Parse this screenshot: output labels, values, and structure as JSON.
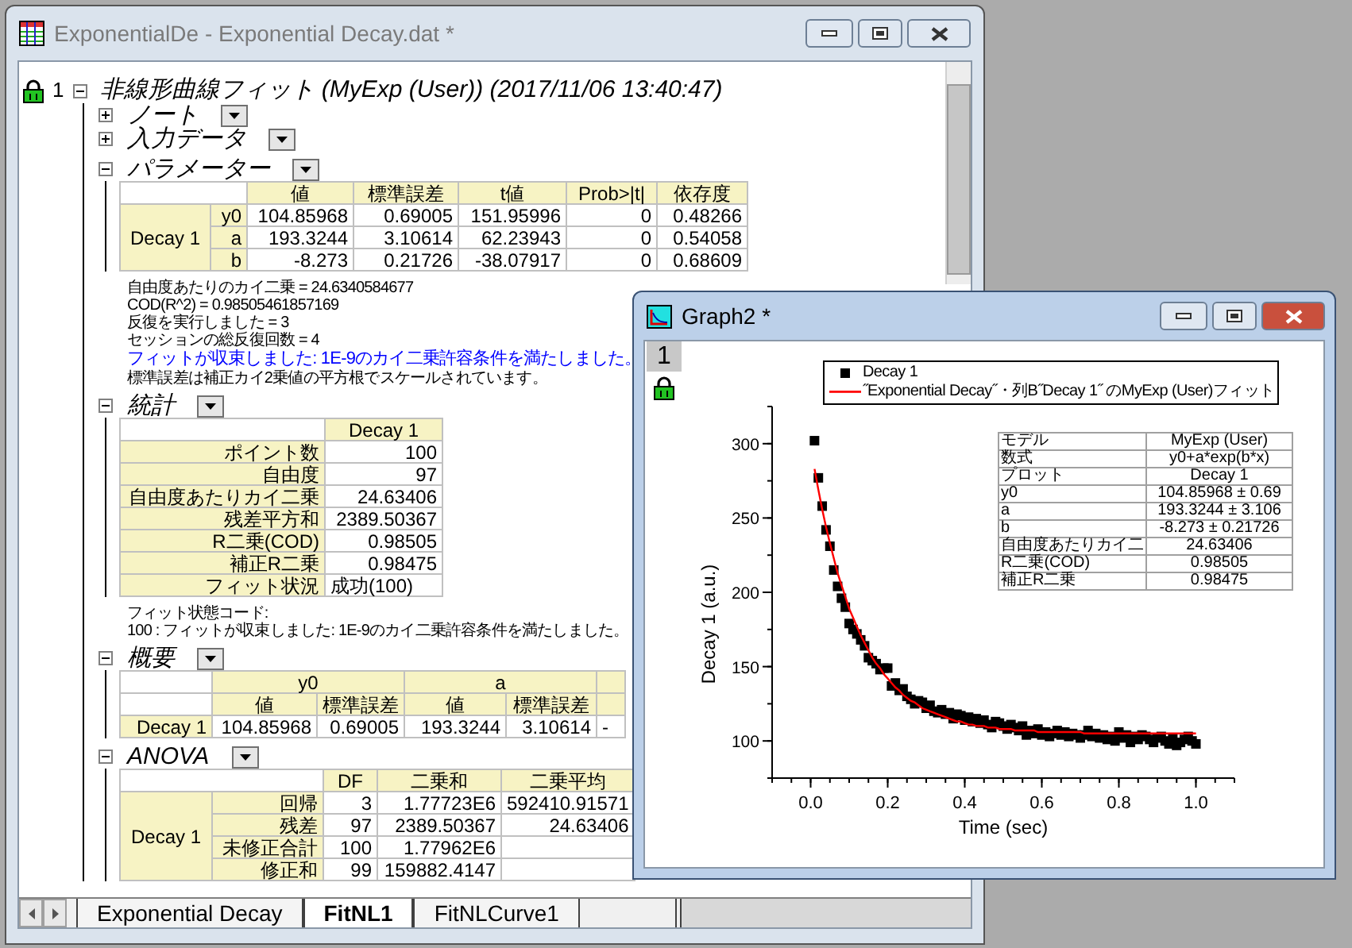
{
  "report_window": {
    "title": "ExponentialDe - Exponential Decay.dat *",
    "active": false,
    "layer": "1",
    "report": {
      "title": "非線形曲線フィット (MyExp (User)) (2017/11/06 13:40:47)",
      "expanded": true
    },
    "sections": [
      {
        "kind": "heading",
        "title": "ノート",
        "expanded": false
      },
      {
        "kind": "heading",
        "title": "入力データ",
        "expanded": false
      },
      {
        "kind": "parameters",
        "title": "パラメーター",
        "expanded": true,
        "columns": [
          "値",
          "標準誤差",
          "t値",
          "Prob>|t|",
          "依存度"
        ],
        "group": "Decay 1",
        "rows": [
          {
            "label": "y0",
            "cells": [
              "104.85968",
              "0.69005",
              "151.95996",
              "0",
              "0.48266"
            ]
          },
          {
            "label": "a",
            "cells": [
              "193.3244",
              "3.10614",
              "62.23943",
              "0",
              "0.54058"
            ]
          },
          {
            "label": "b",
            "cells": [
              "-8.273",
              "0.21726",
              "-38.07917",
              "0",
              "0.68609"
            ]
          }
        ],
        "notes": [
          {
            "kind": "plain",
            "text": "自由度あたりのカイ二乗 = 24.6340584677"
          },
          {
            "kind": "plain",
            "text": "COD(R^2) = 0.98505461857169"
          },
          {
            "kind": "plain",
            "text": "反復を実行しました = 3"
          },
          {
            "kind": "plain",
            "text": "セッションの総反復回数 = 4"
          },
          {
            "kind": "message",
            "text": "フィットが収束しました:  1E-9のカイ二乗許容条件を満たしました。"
          },
          {
            "kind": "plain",
            "text": "標準誤差は補正カイ2乗値の平方根でスケールされています。"
          }
        ]
      },
      {
        "kind": "statistics",
        "title": "統計",
        "expanded": true,
        "column": "Decay 1",
        "rows": [
          {
            "label": "ポイント数",
            "value": "100",
            "kind": "number"
          },
          {
            "label": "自由度",
            "value": "97",
            "kind": "number"
          },
          {
            "label": "自由度あたりカイ二乗",
            "value": "24.63406",
            "kind": "number"
          },
          {
            "label": "残差平方和",
            "value": "2389.50367",
            "kind": "number"
          },
          {
            "label": "R二乗(COD)",
            "value": "0.98505",
            "kind": "number"
          },
          {
            "label": "補正R二乗",
            "value": "0.98475",
            "kind": "number"
          },
          {
            "label": "フィット状況",
            "value": "成功(100)",
            "kind": "text"
          }
        ],
        "notes": [
          {
            "kind": "plain",
            "text": "フィット状態コード:"
          },
          {
            "kind": "plain",
            "text": "100 : フィットが収束しました:  1E-9のカイ二乗許容条件を満たしました。"
          }
        ]
      },
      {
        "kind": "summary",
        "title": "概要",
        "expanded": true,
        "groups": [
          "y0",
          "a"
        ],
        "subcolumns": [
          "値",
          "標準誤差",
          "値",
          "標準誤差"
        ],
        "rows": [
          {
            "label": "Decay 1",
            "cells": [
              "104.85968",
              "0.69005",
              "193.3244",
              "3.10614",
              "-"
            ]
          }
        ]
      },
      {
        "kind": "anova",
        "title": "ANOVA",
        "expanded": true,
        "columns": [
          "DF",
          "二乗和",
          "二乗平均"
        ],
        "group": "Decay 1",
        "rows": [
          {
            "label": "回帰",
            "cells": [
              "3",
              "1.77723E6",
              "592410.91571"
            ]
          },
          {
            "label": "残差",
            "cells": [
              "97",
              "2389.50367",
              "24.63406"
            ]
          },
          {
            "label": "未修正合計",
            "cells": [
              "100",
              "1.77962E6"
            ]
          },
          {
            "label": "修正和",
            "cells": [
              "99",
              "159882.4147"
            ]
          }
        ]
      }
    ],
    "sheet_tabs": [
      {
        "label": "Exponential Decay",
        "selected": false
      },
      {
        "label": "FitNL1",
        "selected": true
      },
      {
        "label": "FitNLCurve1",
        "selected": false
      }
    ]
  },
  "graph_window": {
    "title": "Graph2 *",
    "active": true,
    "layer": "1",
    "fit_table": [
      {
        "label": "モデル",
        "value": "MyExp (User)"
      },
      {
        "label": "数式",
        "value": "y0+a*exp(b*x)"
      },
      {
        "label": "プロット",
        "value": "Decay 1"
      },
      {
        "label": "y0",
        "value": "104.85968 ± 0.69"
      },
      {
        "label": "a",
        "value": "193.3244 ± 3.106"
      },
      {
        "label": "b",
        "value": "-8.273 ± 0.21726"
      },
      {
        "label": "自由度あたりカイ二",
        "value": "24.63406"
      },
      {
        "label": "R二乗(COD)",
        "value": "0.98505"
      },
      {
        "label": "補正R二乗",
        "value": "0.98475"
      }
    ],
    "chart_data": {
      "type": "scatter",
      "xlabel": "Time (sec)",
      "ylabel": "Decay 1 (a.u.)",
      "xlim": [
        -0.1,
        1.1
      ],
      "ylim": [
        75,
        325
      ],
      "xticks": [
        {
          "value": 0,
          "label": "0.0"
        },
        {
          "value": 0.2,
          "label": "0.2"
        },
        {
          "value": 0.4,
          "label": "0.4"
        },
        {
          "value": 0.6,
          "label": "0.6"
        },
        {
          "value": 0.8,
          "label": "0.8"
        },
        {
          "value": 1,
          "label": "1.0"
        }
      ],
      "yticks": [
        100,
        150,
        200,
        250,
        300
      ],
      "x": [
        0.01,
        0.02,
        0.03,
        0.04,
        0.05,
        0.06,
        0.07,
        0.08,
        0.09,
        0.1,
        0.11,
        0.12,
        0.13,
        0.14,
        0.15,
        0.16,
        0.17,
        0.18,
        0.19,
        0.2,
        0.21,
        0.22,
        0.23,
        0.24,
        0.25,
        0.26,
        0.27,
        0.28,
        0.29,
        0.3,
        0.31,
        0.32,
        0.33,
        0.34,
        0.35,
        0.36,
        0.37,
        0.38,
        0.39,
        0.4,
        0.41,
        0.42,
        0.43,
        0.44,
        0.45,
        0.46,
        0.47,
        0.48,
        0.49,
        0.5,
        0.51,
        0.52,
        0.53,
        0.54,
        0.55,
        0.56,
        0.57,
        0.58,
        0.59,
        0.6,
        0.61,
        0.62,
        0.63,
        0.64,
        0.65,
        0.66,
        0.67,
        0.68,
        0.69,
        0.7,
        0.71,
        0.72,
        0.73,
        0.74,
        0.75,
        0.76,
        0.77,
        0.78,
        0.79,
        0.8,
        0.81,
        0.82,
        0.83,
        0.84,
        0.85,
        0.86,
        0.87,
        0.88,
        0.89,
        0.9,
        0.91,
        0.92,
        0.93,
        0.94,
        0.95,
        0.96,
        0.97,
        0.98,
        0.99,
        1
      ],
      "series": [
        {
          "name": "Decay 1",
          "color": "#000000",
          "values": [
            302,
            277,
            258,
            242,
            231,
            215,
            204,
            196,
            190,
            179,
            175,
            172,
            168,
            164,
            156,
            154,
            152,
            148,
            149,
            149,
            137,
            139,
            134,
            135,
            130,
            128,
            125,
            127,
            126,
            122,
            124,
            120,
            119,
            121,
            118,
            119,
            115,
            118,
            117,
            114,
            116,
            113,
            115,
            112,
            114,
            111,
            109,
            113,
            112,
            110,
            108,
            111,
            109,
            107,
            110,
            104,
            107,
            105,
            108,
            104,
            106,
            103,
            105,
            107,
            104,
            106,
            103,
            105,
            104,
            102,
            104,
            107,
            103,
            105,
            102,
            104,
            101,
            103,
            100,
            106,
            102,
            104,
            99,
            103,
            101,
            104,
            103,
            101,
            99,
            102,
            103,
            100,
            98,
            102,
            97,
            99,
            101,
            103,
            100,
            98
          ]
        },
        {
          "name": "˝Exponential Decay˝・列B˝Decay 1˝ のMyExp (User)フィット",
          "type": "line",
          "color": "#ff0000",
          "values": [
            283,
            269,
            256,
            244,
            233,
            223,
            213,
            205,
            197,
            189,
            183,
            177,
            171,
            166,
            161,
            156,
            152,
            149,
            145,
            142,
            139,
            136,
            134,
            131,
            129,
            127,
            126,
            124,
            122,
            121,
            120,
            119,
            118,
            117,
            116,
            115,
            114,
            113,
            113,
            112,
            111,
            111,
            110,
            110,
            110,
            109,
            109,
            109,
            108,
            108,
            108,
            108,
            107,
            107,
            107,
            107,
            107,
            107,
            106,
            106,
            106,
            106,
            106,
            106,
            106,
            106,
            106,
            106,
            106,
            106,
            105,
            105,
            105,
            105,
            105,
            105,
            105,
            105,
            105,
            105,
            105,
            105,
            105,
            105,
            105,
            105,
            105,
            105,
            105,
            105,
            105,
            105,
            105,
            105,
            105,
            105,
            105,
            105,
            105,
            105
          ]
        }
      ]
    }
  }
}
